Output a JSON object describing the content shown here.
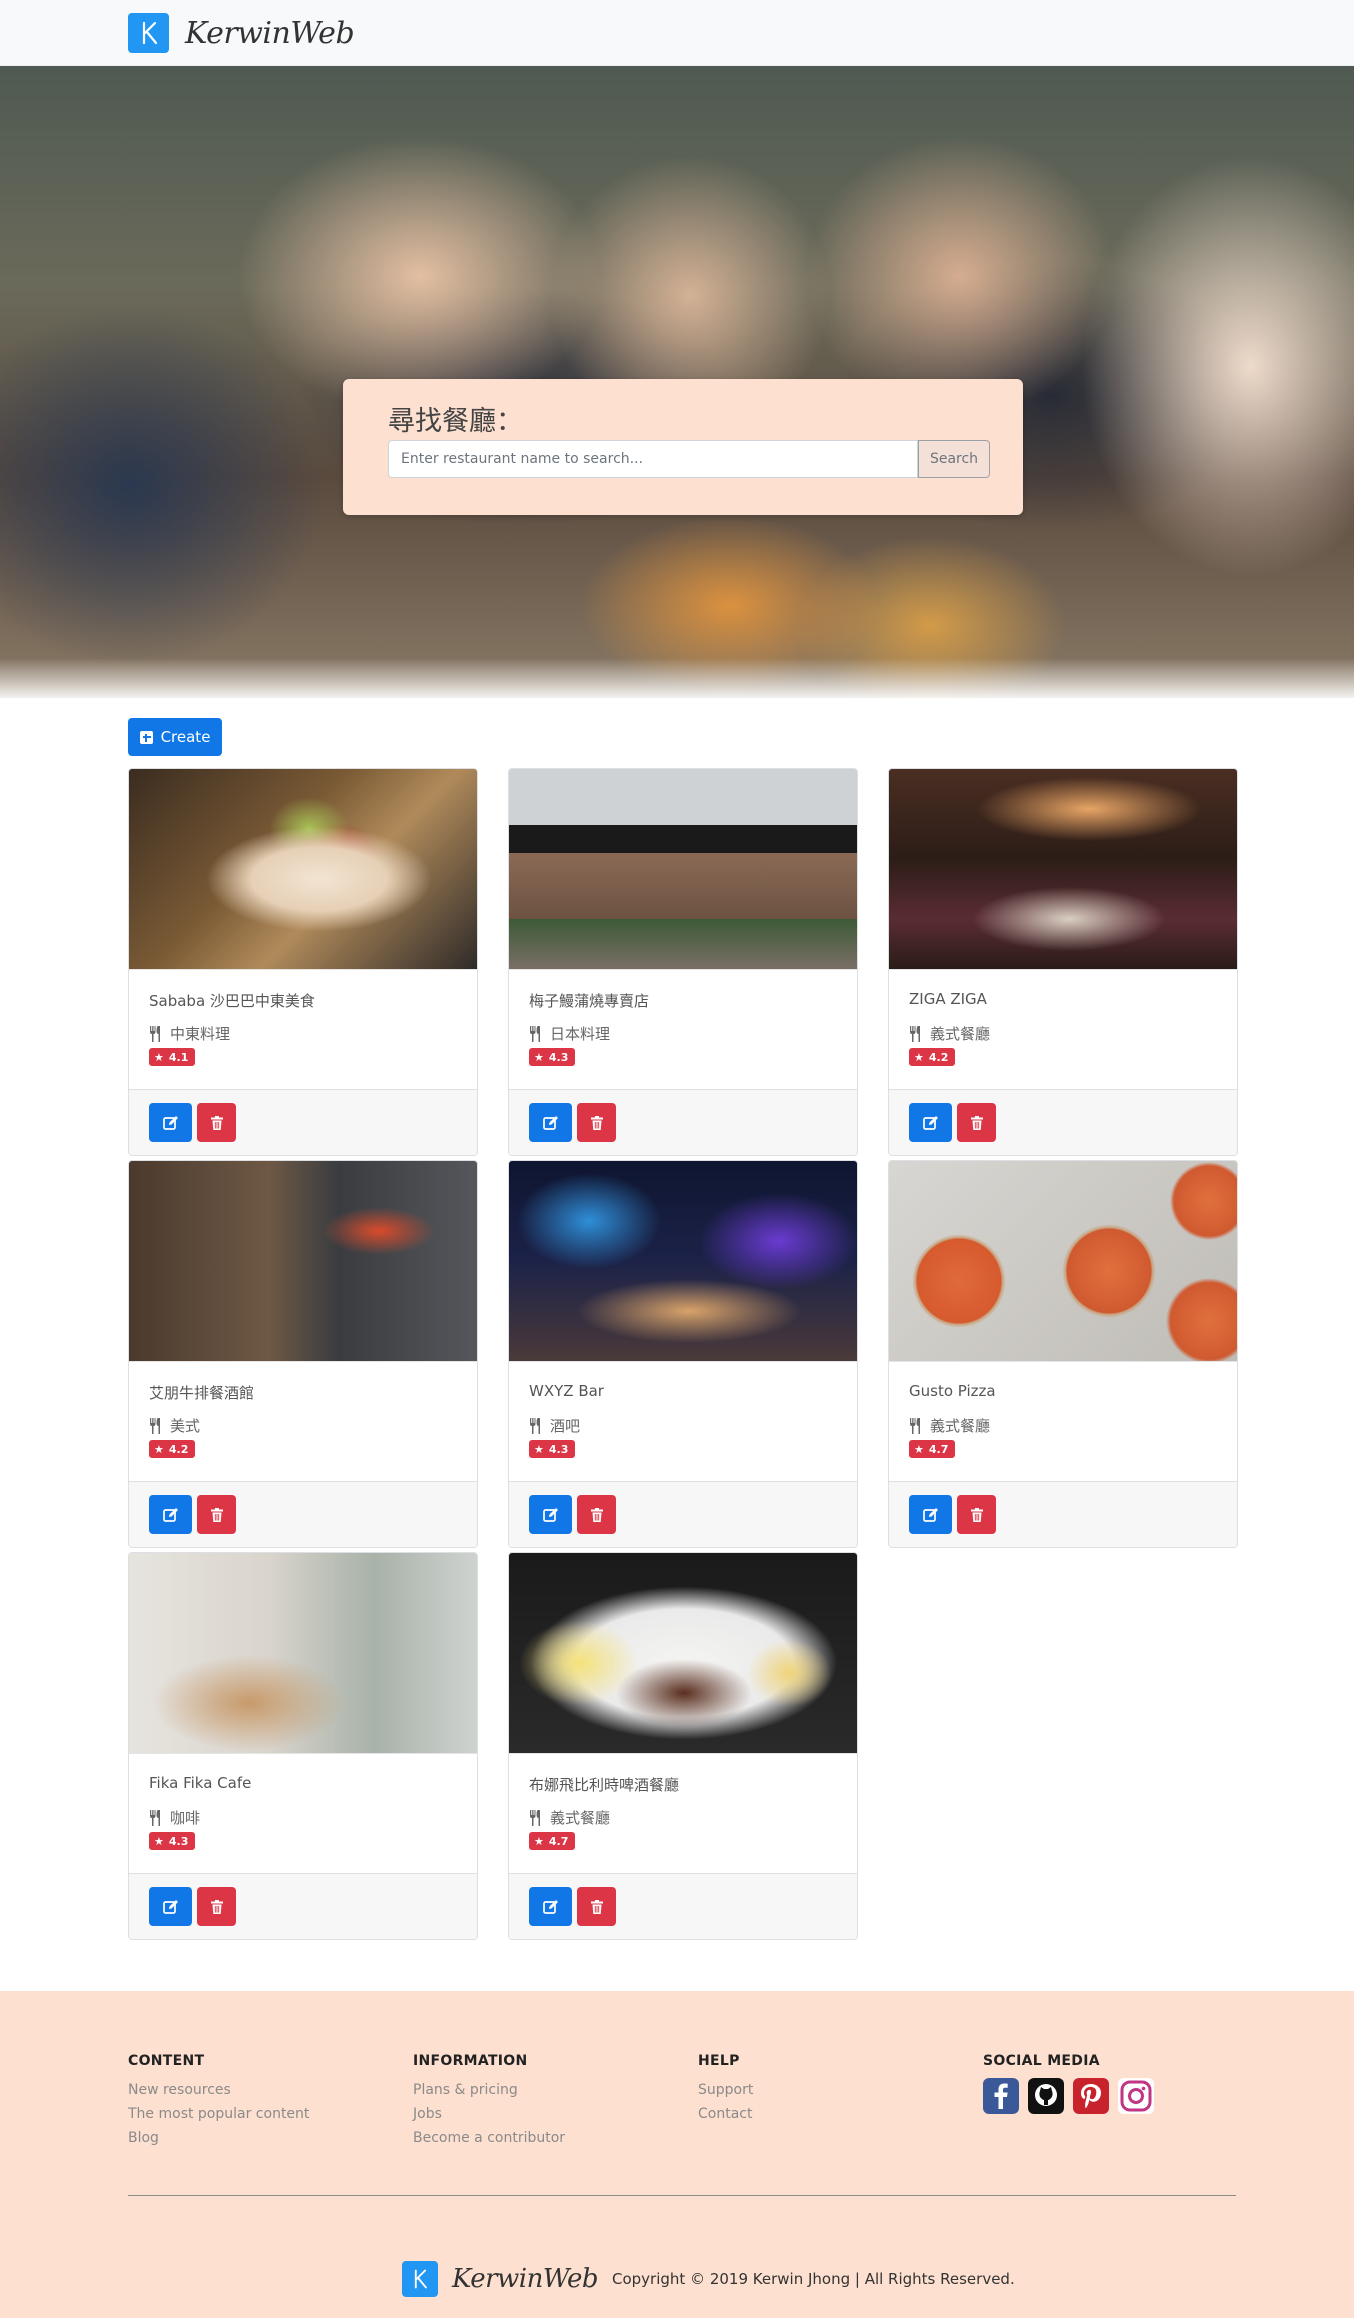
{
  "app": {
    "brand": "KerwinWeb"
  },
  "hero": {
    "search_title": "尋找餐廳：",
    "search_placeholder": "Enter restaurant name to search...",
    "search_button": "Search"
  },
  "actions": {
    "create_label": "Create"
  },
  "restaurants": [
    {
      "name": "Sababa 沙巴巴中東美食",
      "category": "中東料理",
      "rating": "4.1",
      "image": "wrap-food-photo"
    },
    {
      "name": "梅子鰻蒲燒專賣店",
      "category": "日本料理",
      "rating": "4.3",
      "image": "storefront-photo"
    },
    {
      "name": "ZIGA ZIGA",
      "category": "義式餐廳",
      "rating": "4.2",
      "image": "dining-room-photo"
    },
    {
      "name": "艾朋牛排餐酒館",
      "category": "美式",
      "rating": "4.2",
      "image": "steakhouse-interior-photo"
    },
    {
      "name": "WXYZ Bar",
      "category": "酒吧",
      "rating": "4.3",
      "image": "bar-lounge-photo"
    },
    {
      "name": "Gusto Pizza",
      "category": "義式餐廳",
      "rating": "4.7",
      "image": "pizza-photo"
    },
    {
      "name": "Fika Fika Cafe",
      "category": "咖啡",
      "rating": "4.3",
      "image": "cafe-interior-photo"
    },
    {
      "name": "布娜飛比利時啤酒餐廳",
      "category": "義式餐廳",
      "rating": "4.7",
      "image": "breakfast-plate-photo"
    }
  ],
  "footer": {
    "columns": [
      {
        "title": "CONTENT",
        "links": [
          "New resources",
          "The most popular content",
          "Blog"
        ]
      },
      {
        "title": "INFORMATION",
        "links": [
          "Plans & pricing",
          "Jobs",
          "Become a contributor"
        ]
      },
      {
        "title": "HELP",
        "links": [
          "Support",
          "Contact"
        ]
      },
      {
        "title": "SOCIAL MEDIA",
        "links": []
      }
    ],
    "social": [
      {
        "icon": "facebook-icon",
        "color": "#3b5998"
      },
      {
        "icon": "github-icon",
        "color": "#111111"
      },
      {
        "icon": "pinterest-icon",
        "color": "#c8232c"
      },
      {
        "icon": "instagram-icon",
        "color": "#c13584"
      }
    ],
    "copyright": "Copyright © 2019 Kerwin Jhong | All Rights Reserved."
  },
  "colors": {
    "primary": "#1177e6",
    "danger": "#dc3545",
    "accent_bg": "#fde0d0",
    "logo": "#2196f3"
  }
}
